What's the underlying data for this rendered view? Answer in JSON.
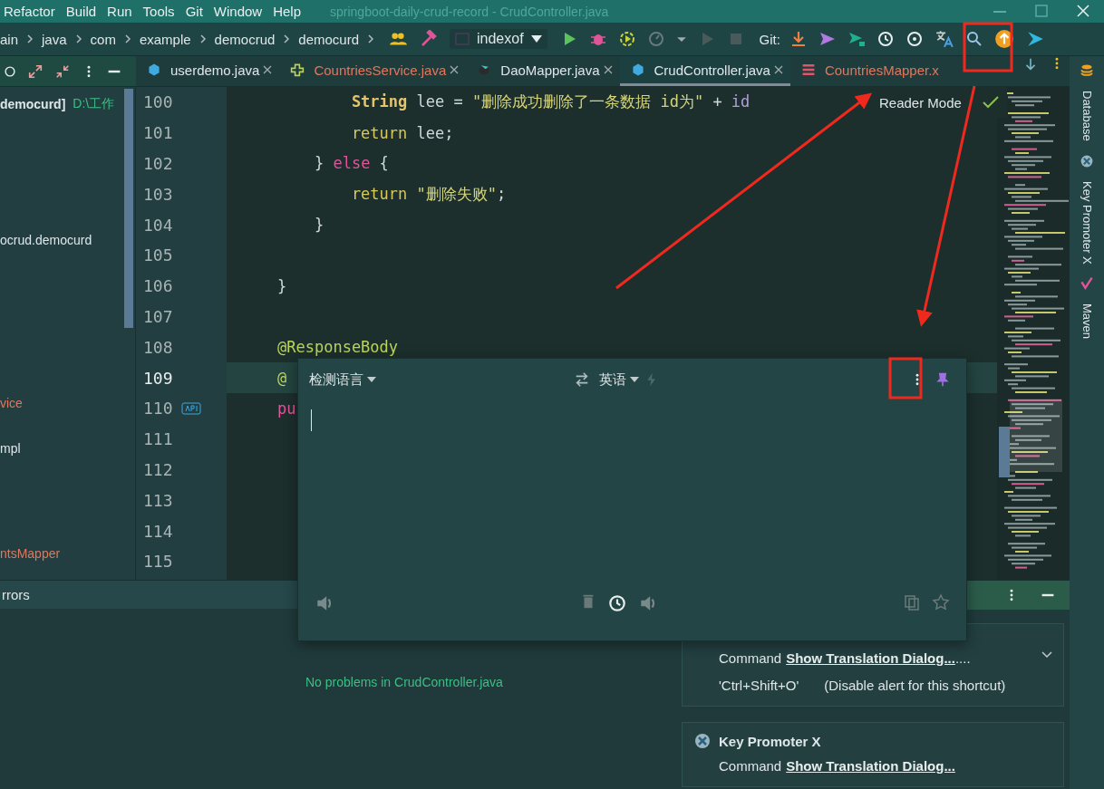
{
  "menu": [
    "Refactor",
    "Build",
    "Run",
    "Tools",
    "Git",
    "Window",
    "Help"
  ],
  "window_title": "springboot-daily-crud-record - CrudController.java",
  "breadcrumbs": [
    "ain",
    "java",
    "com",
    "example",
    "democrud",
    "democurd"
  ],
  "run_config": "indexof",
  "git_label": "Git:",
  "tabs": [
    {
      "label": "userdemo.java",
      "kind": "class",
      "color": "#dfe6e9",
      "selected": false
    },
    {
      "label": "CountriesService.java",
      "kind": "service",
      "color": "#e0775f",
      "selected": false
    },
    {
      "label": "DaoMapper.java",
      "kind": "mapper",
      "color": "#dfe6e9",
      "selected": false
    },
    {
      "label": "CrudController.java",
      "kind": "class",
      "color": "#dfe6e9",
      "selected": true
    },
    {
      "label": "CountriesMapper.x",
      "kind": "xml",
      "color": "#e0775f",
      "selected": false
    }
  ],
  "project": {
    "root": "democurd]",
    "root_path": "D:\\工作",
    "items": [
      {
        "label": "ocrud.democurd",
        "color": "#dfe6e9"
      },
      {
        "label": "vice",
        "color": "#e0775f"
      },
      {
        "label": "mpl",
        "color": "#dfe6e9"
      },
      {
        "label": "ntsMapper",
        "color": "#e0775f"
      }
    ]
  },
  "code_lines": [
    {
      "number": "100",
      "current": false,
      "tokens": [
        {
          "t": "        String",
          "kind": "type"
        },
        {
          "t": " lee = ",
          "kind": "plain"
        },
        {
          "t": "\"删除成功删除了一条数据 id为\"",
          "kind": "str"
        },
        {
          "t": " + ",
          "kind": "plain"
        },
        {
          "t": "id",
          "kind": "field"
        }
      ]
    },
    {
      "number": "101",
      "current": false,
      "tokens": [
        {
          "t": "        return",
          "kind": "kw"
        },
        {
          "t": " lee;",
          "kind": "plain"
        }
      ]
    },
    {
      "number": "102",
      "current": false,
      "tokens": [
        {
          "t": "    } ",
          "kind": "plain"
        },
        {
          "t": "else",
          "kind": "kw2"
        },
        {
          "t": " {",
          "kind": "plain"
        }
      ]
    },
    {
      "number": "103",
      "current": false,
      "tokens": [
        {
          "t": "        return",
          "kind": "kw"
        },
        {
          "t": " \"删除失败\"",
          "kind": "str"
        },
        {
          "t": ";",
          "kind": "plain"
        }
      ]
    },
    {
      "number": "104",
      "current": false,
      "tokens": [
        {
          "t": "    }",
          "kind": "plain"
        }
      ]
    },
    {
      "number": "105",
      "current": false
    },
    {
      "number": "106",
      "current": false,
      "tokens": [
        {
          "t": "}",
          "kind": "plain"
        }
      ]
    },
    {
      "number": "107",
      "current": false
    },
    {
      "number": "108",
      "current": false,
      "tokens": [
        {
          "t": "@ResponseBody",
          "kind": "ann"
        }
      ]
    },
    {
      "number": "109",
      "current": true,
      "tokens": [
        {
          "t": "@",
          "kind": "ann"
        }
      ]
    },
    {
      "number": "110",
      "current": false,
      "api": true,
      "tokens": [
        {
          "t": "pu",
          "kind": "kw2"
        }
      ]
    },
    {
      "number": "111",
      "current": false
    },
    {
      "number": "112",
      "current": false
    },
    {
      "number": "113",
      "current": false
    },
    {
      "number": "114",
      "current": false
    },
    {
      "number": "115",
      "current": false
    }
  ],
  "reader_mode": "Reader Mode",
  "translator": {
    "source": "检测语言",
    "target": "英语"
  },
  "bottom": {
    "tab": "rrors",
    "message": "No problems in CrudController.java"
  },
  "notifications": [
    {
      "command_prefix": "Command",
      "command": "Show Translation Dialog...",
      "suffix": "....",
      "shortcut": "'Ctrl+Shift+O'",
      "disable": "(Disable alert for this shortcut)",
      "expandable": true
    },
    {
      "title": "Key Promoter X",
      "command_prefix": "Command",
      "command": "Show Translation Dialog...",
      "expandable": false
    }
  ],
  "right_tools": [
    "Database",
    "Key Promoter X",
    "Maven"
  ]
}
